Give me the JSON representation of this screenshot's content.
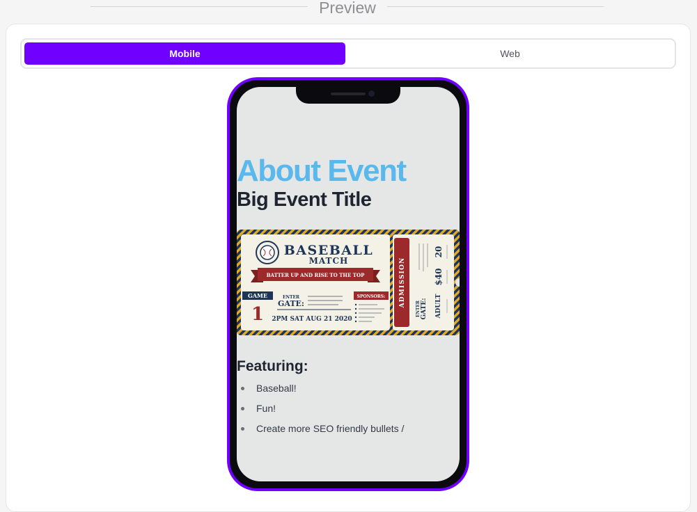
{
  "section_title": "Preview",
  "view_toggle": {
    "mobile_label": "Mobile",
    "web_label": "Web",
    "selected": "Mobile"
  },
  "colors": {
    "accent": "#7000ff",
    "about_heading": "#5ab8ec",
    "ticket_navy": "#1d3557",
    "ticket_red": "#9c2a2a",
    "ticket_stripe": "#e1a92b",
    "ticket_cream": "#f4f1e6"
  },
  "content": {
    "about_heading": "About Event",
    "event_title": "Big Event Title",
    "featuring_heading": "Featuring:",
    "bullets": [
      "Baseball!",
      "Fun!",
      "Create more SEO friendly bullets /"
    ]
  },
  "ticket": {
    "title": "BASEBALL",
    "subtitle": "MATCH",
    "tagline": "BATTER UP AND RISE TO THE TOP",
    "game_label": "GAME",
    "game_number": "1",
    "enter_label": "ENTER",
    "gate_label": "GATE:",
    "datetime": "2PM SAT AUG 21 2020",
    "sponsors_label": "SPONSORS:",
    "admission_label": "ADMISSION",
    "stub_price": "$40",
    "stub_adult": "ADULT",
    "stub_number": "20",
    "stub_enter": "ENTER",
    "stub_gate": "GATE:"
  }
}
